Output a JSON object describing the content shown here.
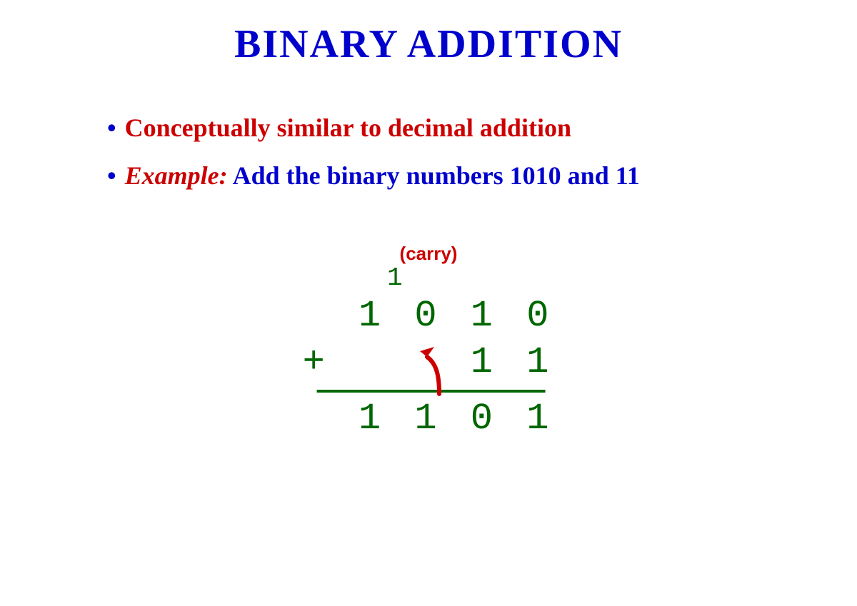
{
  "title": "BINARY  ADDITION",
  "bullets": {
    "b1": "Conceptually similar to decimal addition",
    "b2_label": "Example:",
    "b2_rest": "  Add the binary numbers 1010 and 11"
  },
  "work": {
    "carry_label": "(carry)",
    "carry_row": "    1    ",
    "addend1": "  1 0 1 0",
    "addend2": "+     1 1",
    "result": "  1 1 0 1"
  }
}
